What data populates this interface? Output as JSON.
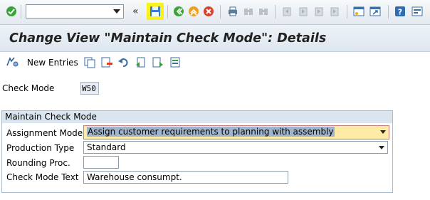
{
  "toolbar": {
    "command_field": {
      "value": "",
      "placeholder": ""
    },
    "nav_arrows": "«",
    "icons": [
      "enter-check-icon",
      "save-icon",
      "back-icon",
      "exit-icon",
      "cancel-icon",
      "print-icon",
      "find-icon",
      "find-next-icon",
      "first-page-icon",
      "previous-page-icon",
      "next-page-icon",
      "last-page-icon",
      "create-session-icon",
      "shortcut-icon",
      "help-icon",
      "customize-layout-icon"
    ]
  },
  "title": "Change View \"Maintain Check Mode\": Details",
  "app_toolbar": {
    "new_entries_label": "New Entries",
    "icons": [
      "change-display-icon",
      "copy-icon",
      "delete-icon",
      "undo-icon",
      "previous-entry-icon",
      "next-entry-icon",
      "variant-icon"
    ]
  },
  "check_mode": {
    "label": "Check Mode",
    "value": "W50"
  },
  "group": {
    "title": "Maintain Check Mode",
    "rows": [
      {
        "label": "Assignment Mode",
        "value": "Assign customer requirements to planning with assembly",
        "type": "dropdown"
      },
      {
        "label": "Production Type",
        "value": "Standard",
        "type": "dropdown"
      },
      {
        "label": "Rounding Proc.",
        "value": "",
        "type": "input"
      },
      {
        "label": "Check Mode Text",
        "value": "Warehouse consumpt.",
        "type": "input"
      }
    ]
  },
  "colors": {
    "highlight_yellow": "#f7f21d",
    "focused_field": "#fdeba6",
    "selection": "#9fb5cd",
    "title_bg": "#dfe7ef"
  }
}
